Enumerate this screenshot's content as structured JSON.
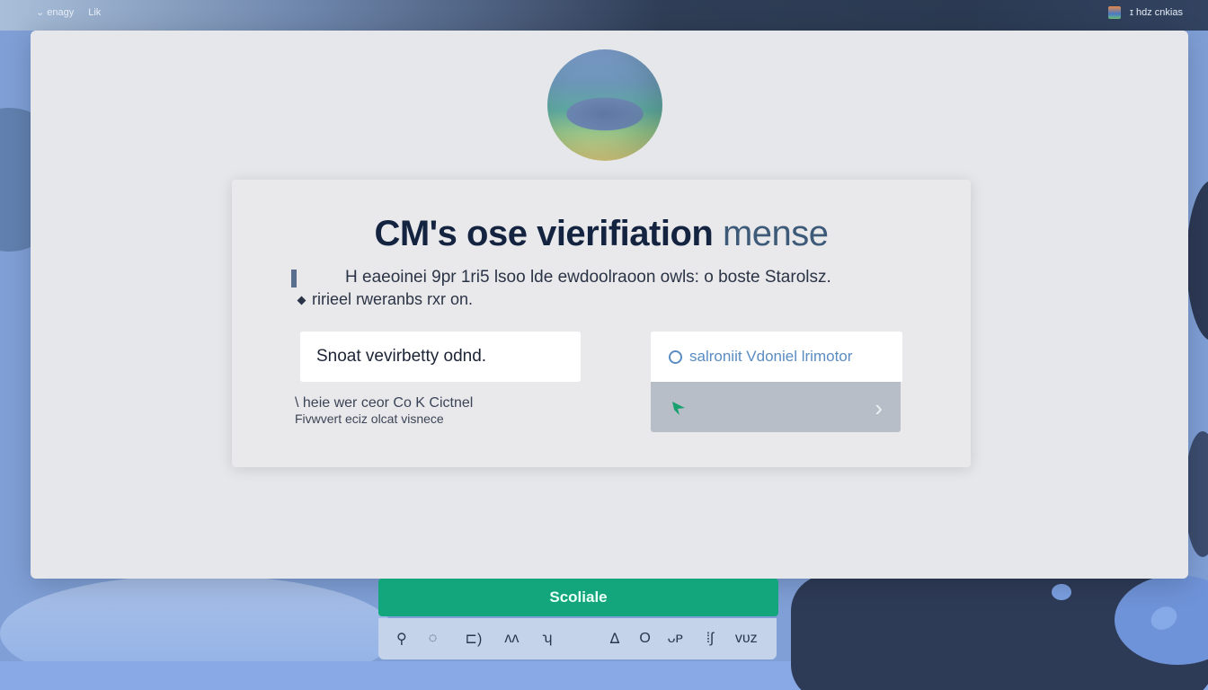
{
  "topbar": {
    "left_label_1": "⌄ enagy",
    "left_label_2": "Lik",
    "right_label": "ɪ hdz cnkias"
  },
  "card": {
    "title_main": "CM's ose vierifiation",
    "title_accent": "mense",
    "desc_line1": "H eaeoinei 9pr 1ri5 lsoo lde ewdoolraoon owls: o boste Starolsz.",
    "desc_line2": "ririeel rweranbs rxr on.",
    "code_input_value": "Snoat vevirbetty odnd.",
    "hint_line1": "\\ heie wer ceor Co K Cictnel",
    "hint_line2": "Fivwvert eciz olcat visnece",
    "alt_option_label": "salroniit Vdoniel lrimotor"
  },
  "bottom": {
    "primary_button": "Scoliale",
    "tools": [
      "⚲",
      "◌",
      "⊏)",
      "ᴧᴧ",
      "ʮ",
      "",
      "ᐃ",
      "O",
      "ᴗᴘ",
      "⁞ʃ",
      "ᴠᴜᴢ"
    ]
  },
  "colors": {
    "primary": "#13a67c",
    "title": "#142440",
    "link": "#5a8cc2",
    "window_bg": "#e6e7ea"
  }
}
